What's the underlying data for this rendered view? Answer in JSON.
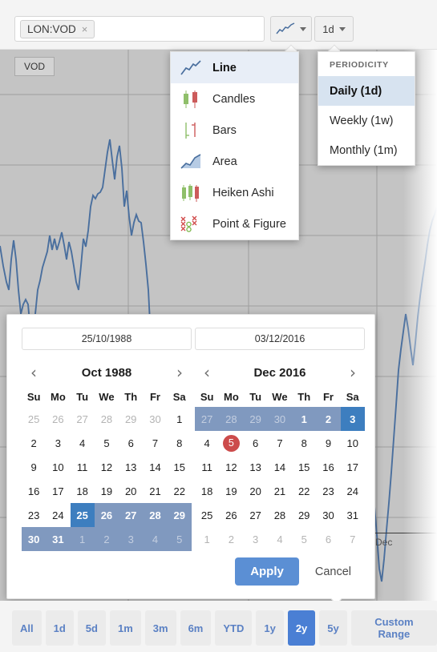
{
  "toolbar": {
    "symbol_tag": "LON:VOD",
    "symbol_close": "×",
    "symbol_placeholder": "",
    "charttype_button_icon": "line-chart-icon",
    "period_button_label": "1d"
  },
  "chart": {
    "series_badge": "VOD",
    "axis_label_dec": "Dec",
    "line_color": "#4a6f9e",
    "background": "#c4c4c4"
  },
  "charttype_menu": {
    "items": [
      {
        "label": "Line",
        "icon": "line-chart-icon",
        "selected": true
      },
      {
        "label": "Candles",
        "icon": "candlestick-icon",
        "selected": false
      },
      {
        "label": "Bars",
        "icon": "ohlc-bars-icon",
        "selected": false
      },
      {
        "label": "Area",
        "icon": "area-chart-icon",
        "selected": false
      },
      {
        "label": "Heiken Ashi",
        "icon": "heiken-ashi-icon",
        "selected": false
      },
      {
        "label": "Point & Figure",
        "icon": "point-and-figure-icon",
        "selected": false
      }
    ]
  },
  "period_menu": {
    "header": "PERIODICITY",
    "items": [
      {
        "label": "Daily (1d)",
        "selected": true
      },
      {
        "label": "Weekly (1w)",
        "selected": false
      },
      {
        "label": "Monthly (1m)",
        "selected": false
      }
    ]
  },
  "datepicker": {
    "start_input_value": "25/10/1988",
    "end_input_value": "03/12/2016",
    "prev_icon": "‹",
    "next_icon": "›",
    "dow": [
      "Su",
      "Mo",
      "Tu",
      "We",
      "Th",
      "Fr",
      "Sa"
    ],
    "left_calendar": {
      "title": "Oct 1988",
      "weeks": [
        [
          {
            "d": "25",
            "s": "mute"
          },
          {
            "d": "26",
            "s": "mute"
          },
          {
            "d": "27",
            "s": "mute"
          },
          {
            "d": "28",
            "s": "mute"
          },
          {
            "d": "29",
            "s": "mute"
          },
          {
            "d": "30",
            "s": "mute"
          },
          {
            "d": "1",
            "s": ""
          }
        ],
        [
          {
            "d": "2",
            "s": ""
          },
          {
            "d": "3",
            "s": ""
          },
          {
            "d": "4",
            "s": ""
          },
          {
            "d": "5",
            "s": ""
          },
          {
            "d": "6",
            "s": ""
          },
          {
            "d": "7",
            "s": ""
          },
          {
            "d": "8",
            "s": ""
          }
        ],
        [
          {
            "d": "9",
            "s": ""
          },
          {
            "d": "10",
            "s": ""
          },
          {
            "d": "11",
            "s": ""
          },
          {
            "d": "12",
            "s": ""
          },
          {
            "d": "13",
            "s": ""
          },
          {
            "d": "14",
            "s": ""
          },
          {
            "d": "15",
            "s": ""
          }
        ],
        [
          {
            "d": "16",
            "s": ""
          },
          {
            "d": "17",
            "s": ""
          },
          {
            "d": "18",
            "s": ""
          },
          {
            "d": "19",
            "s": ""
          },
          {
            "d": "20",
            "s": ""
          },
          {
            "d": "21",
            "s": ""
          },
          {
            "d": "22",
            "s": ""
          }
        ],
        [
          {
            "d": "23",
            "s": ""
          },
          {
            "d": "24",
            "s": ""
          },
          {
            "d": "25",
            "s": "edge"
          },
          {
            "d": "26",
            "s": "inrange bold"
          },
          {
            "d": "27",
            "s": "inrange bold"
          },
          {
            "d": "28",
            "s": "inrange bold"
          },
          {
            "d": "29",
            "s": "inrange bold"
          }
        ],
        [
          {
            "d": "30",
            "s": "inrange bold"
          },
          {
            "d": "31",
            "s": "inrange bold"
          },
          {
            "d": "1",
            "s": "inrange mute"
          },
          {
            "d": "2",
            "s": "inrange mute"
          },
          {
            "d": "3",
            "s": "inrange mute"
          },
          {
            "d": "4",
            "s": "inrange mute"
          },
          {
            "d": "5",
            "s": "inrange mute"
          }
        ]
      ]
    },
    "right_calendar": {
      "title": "Dec 2016",
      "weeks": [
        [
          {
            "d": "27",
            "s": "inrange mute"
          },
          {
            "d": "28",
            "s": "inrange mute"
          },
          {
            "d": "29",
            "s": "inrange mute"
          },
          {
            "d": "30",
            "s": "inrange mute"
          },
          {
            "d": "1",
            "s": "inrange bold"
          },
          {
            "d": "2",
            "s": "inrange bold"
          },
          {
            "d": "3",
            "s": "edge"
          }
        ],
        [
          {
            "d": "4",
            "s": ""
          },
          {
            "d": "5",
            "s": "today"
          },
          {
            "d": "6",
            "s": ""
          },
          {
            "d": "7",
            "s": ""
          },
          {
            "d": "8",
            "s": ""
          },
          {
            "d": "9",
            "s": ""
          },
          {
            "d": "10",
            "s": ""
          }
        ],
        [
          {
            "d": "11",
            "s": ""
          },
          {
            "d": "12",
            "s": ""
          },
          {
            "d": "13",
            "s": ""
          },
          {
            "d": "14",
            "s": ""
          },
          {
            "d": "15",
            "s": ""
          },
          {
            "d": "16",
            "s": ""
          },
          {
            "d": "17",
            "s": ""
          }
        ],
        [
          {
            "d": "18",
            "s": ""
          },
          {
            "d": "19",
            "s": ""
          },
          {
            "d": "20",
            "s": ""
          },
          {
            "d": "21",
            "s": ""
          },
          {
            "d": "22",
            "s": ""
          },
          {
            "d": "23",
            "s": ""
          },
          {
            "d": "24",
            "s": ""
          }
        ],
        [
          {
            "d": "25",
            "s": ""
          },
          {
            "d": "26",
            "s": ""
          },
          {
            "d": "27",
            "s": ""
          },
          {
            "d": "28",
            "s": ""
          },
          {
            "d": "29",
            "s": ""
          },
          {
            "d": "30",
            "s": ""
          },
          {
            "d": "31",
            "s": ""
          }
        ],
        [
          {
            "d": "1",
            "s": "mute"
          },
          {
            "d": "2",
            "s": "mute"
          },
          {
            "d": "3",
            "s": "mute"
          },
          {
            "d": "4",
            "s": "mute"
          },
          {
            "d": "5",
            "s": "mute"
          },
          {
            "d": "6",
            "s": "mute"
          },
          {
            "d": "7",
            "s": "mute"
          }
        ]
      ]
    },
    "apply_label": "Apply",
    "cancel_label": "Cancel"
  },
  "rangebar": {
    "buttons": [
      {
        "label": "All",
        "active": false
      },
      {
        "label": "1d",
        "active": false
      },
      {
        "label": "5d",
        "active": false
      },
      {
        "label": "1m",
        "active": false
      },
      {
        "label": "3m",
        "active": false
      },
      {
        "label": "6m",
        "active": false
      },
      {
        "label": "YTD",
        "active": false
      },
      {
        "label": "1y",
        "active": false
      },
      {
        "label": "2y",
        "active": true
      },
      {
        "label": "5y",
        "active": false
      },
      {
        "label": "Custom Range",
        "active": false
      }
    ]
  },
  "colors": {
    "accent_blue": "#4a7fd4",
    "range_fill": "#8099bf",
    "edge_blue": "#3d7ebf",
    "today_red": "#cc4b4b",
    "link_blue": "#5b81c4"
  }
}
